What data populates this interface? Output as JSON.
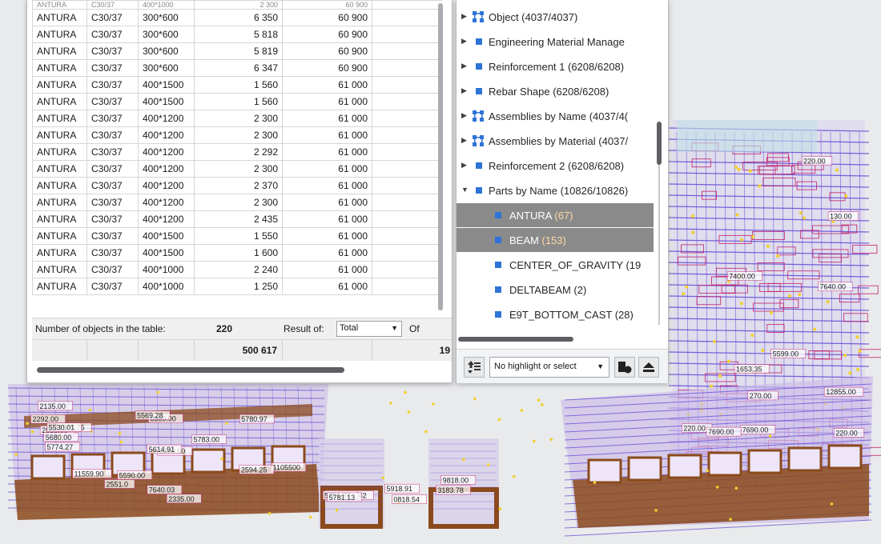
{
  "table": {
    "cut_row": [
      "ANTURA",
      "C30/37",
      "400*1000",
      "2 300",
      "60 900"
    ],
    "rows": [
      [
        "ANTURA",
        "C30/37",
        "300*600",
        "6 350",
        "60 900"
      ],
      [
        "ANTURA",
        "C30/37",
        "300*600",
        "5 818",
        "60 900"
      ],
      [
        "ANTURA",
        "C30/37",
        "300*600",
        "5 819",
        "60 900"
      ],
      [
        "ANTURA",
        "C30/37",
        "300*600",
        "6 347",
        "60 900"
      ],
      [
        "ANTURA",
        "C30/37",
        "400*1500",
        "1 560",
        "61 000"
      ],
      [
        "ANTURA",
        "C30/37",
        "400*1500",
        "1 560",
        "61 000"
      ],
      [
        "ANTURA",
        "C30/37",
        "400*1200",
        "2 300",
        "61 000"
      ],
      [
        "ANTURA",
        "C30/37",
        "400*1200",
        "2 300",
        "61 000"
      ],
      [
        "ANTURA",
        "C30/37",
        "400*1200",
        "2 292",
        "61 000"
      ],
      [
        "ANTURA",
        "C30/37",
        "400*1200",
        "2 300",
        "61 000"
      ],
      [
        "ANTURA",
        "C30/37",
        "400*1200",
        "2 370",
        "61 000"
      ],
      [
        "ANTURA",
        "C30/37",
        "400*1200",
        "2 300",
        "61 000"
      ],
      [
        "ANTURA",
        "C30/37",
        "400*1200",
        "2 435",
        "61 000"
      ],
      [
        "ANTURA",
        "C30/37",
        "400*1500",
        "1 550",
        "61 000"
      ],
      [
        "ANTURA",
        "C30/37",
        "400*1500",
        "1 600",
        "61 000"
      ],
      [
        "ANTURA",
        "C30/37",
        "400*1000",
        "2 240",
        "61 000"
      ],
      [
        "ANTURA",
        "C30/37",
        "400*1000",
        "1 250",
        "61 000"
      ]
    ],
    "summary": {
      "count_label": "Number of objects in the table:",
      "count_value": "220",
      "result_label": "Result of:",
      "result_value": "Total",
      "of_label": "Of"
    },
    "totals": {
      "col4": "500 617",
      "col6": "19"
    }
  },
  "tree": {
    "items": [
      {
        "label": "Object (4037/4037)",
        "icon": "assembly",
        "expander": "▶",
        "selected": false
      },
      {
        "label": "Engineering Material Manage",
        "icon": "square",
        "expander": "▶",
        "selected": false
      },
      {
        "label": "Reinforcement 1 (6208/6208)",
        "icon": "square",
        "expander": "▶",
        "selected": false
      },
      {
        "label": "Rebar Shape (6208/6208)",
        "icon": "square",
        "expander": "▶",
        "selected": false
      },
      {
        "label": "Assemblies by Name (4037/4(",
        "icon": "assembly",
        "expander": "▶",
        "selected": false
      },
      {
        "label": "Assemblies by Material (4037/",
        "icon": "assembly",
        "expander": "▶",
        "selected": false
      },
      {
        "label": "Reinforcement 2 (6208/6208)",
        "icon": "square",
        "expander": "▶",
        "selected": false
      },
      {
        "label": "Parts by Name (10826/10826)",
        "icon": "square",
        "expander": "▼",
        "selected": false
      },
      {
        "label": "ANTURA",
        "count": "(67)",
        "icon": "square",
        "expander": "",
        "selected": true
      },
      {
        "label": "BEAM",
        "count": "(153)",
        "icon": "square",
        "expander": "",
        "selected": true
      },
      {
        "label": "CENTER_OF_GRAVITY (19",
        "icon": "square",
        "expander": "",
        "selected": false
      },
      {
        "label": "DELTABEAM (2)",
        "icon": "square",
        "expander": "",
        "selected": false
      },
      {
        "label": "E9T_BOTTOM_CAST (28)",
        "icon": "square",
        "expander": "",
        "selected": false
      }
    ],
    "toolbar": {
      "highlight_select": "No highlight or select"
    }
  },
  "model_labels": {
    "left": [
      "2292.00",
      "2290.00",
      "2335.00",
      "2555.00",
      "2135.00",
      "1985.75",
      "5530.01",
      "5680.00",
      "2551.0",
      "5614.91",
      "1105500",
      "5590.00",
      "5580.00",
      "5780.97",
      "5783.00",
      "7640.03",
      "5774.27",
      "5569.28",
      "2594.25",
      "11559.90"
    ],
    "middle": [
      "5847.42",
      "9818.00",
      "5918.91",
      "5761.97",
      "3183.78",
      "5781.13",
      "0818.54"
    ],
    "right": [
      "220.00",
      "270.00",
      "220.00",
      "220.00",
      "130.00",
      "7400.00",
      "12855.00",
      "7640.00",
      "7690.00",
      "7690.00",
      "5599.00",
      "1653.35"
    ]
  },
  "colors": {
    "selected_bg": "#8a8a8a",
    "tree_icon": "#2d74d6",
    "rebar": "#5b3fd4",
    "concrete": "#8b4a1c"
  }
}
